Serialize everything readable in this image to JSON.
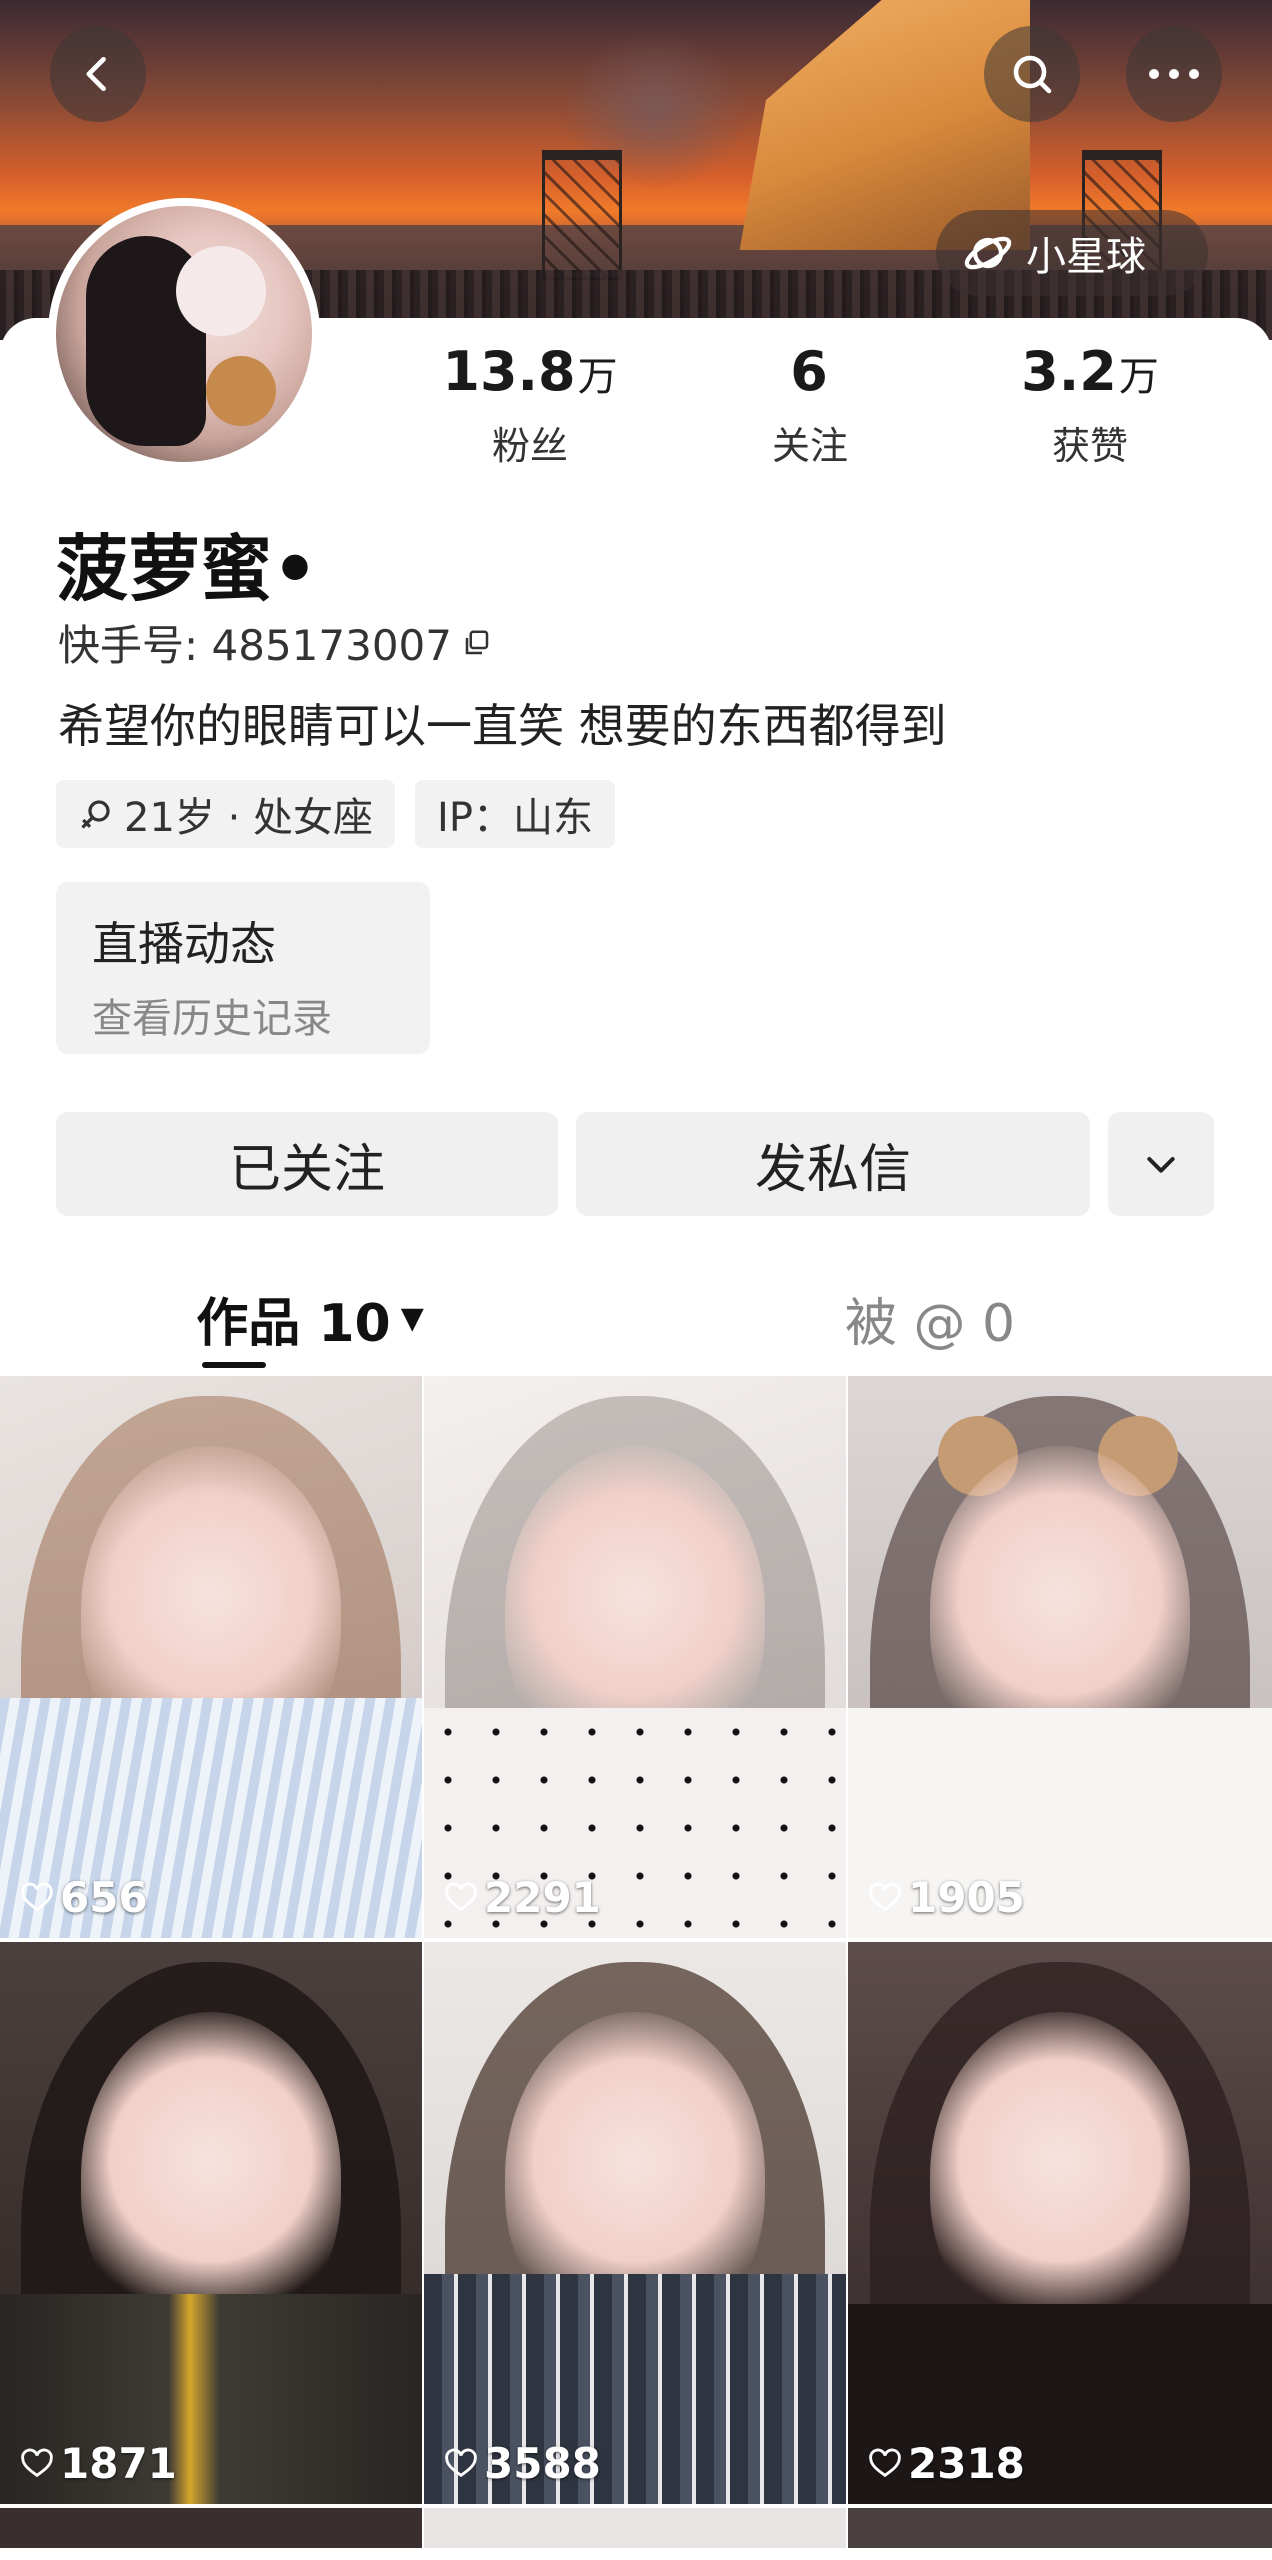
{
  "header": {
    "back_icon": "chevron-left-icon",
    "search_icon": "search-icon",
    "more_icon": "more-horizontal-icon",
    "planet_label": "小星球",
    "planet_icon": "planet-icon"
  },
  "profile": {
    "stats": [
      {
        "value": "13.8",
        "unit": "万",
        "label": "粉丝"
      },
      {
        "value": "6",
        "unit": "",
        "label": "关注"
      },
      {
        "value": "3.2",
        "unit": "万",
        "label": "获赞"
      }
    ],
    "name": "菠萝蜜•",
    "kuaishou_id": "快手号: 485173007",
    "bio": "希望你的眼睛可以一直笑 想要的东西都得到",
    "tags": [
      {
        "icon": "female-icon",
        "text": "21岁 · 处女座"
      },
      {
        "icon": "",
        "text": "IP：山东"
      }
    ],
    "live_card": {
      "title": "直播动态",
      "subtitle": "查看历史记录"
    }
  },
  "actions": {
    "follow_label": "已关注",
    "message_label": "发私信",
    "more_icon": "chevron-down-icon"
  },
  "tabs": {
    "works_label": "作品 10",
    "mentioned_label": "被 @ 0"
  },
  "grid": {
    "items": [
      {
        "likes": "656"
      },
      {
        "likes": "2291"
      },
      {
        "likes": "1905"
      },
      {
        "likes": "1871"
      },
      {
        "likes": "3588"
      },
      {
        "likes": "2318"
      }
    ]
  }
}
